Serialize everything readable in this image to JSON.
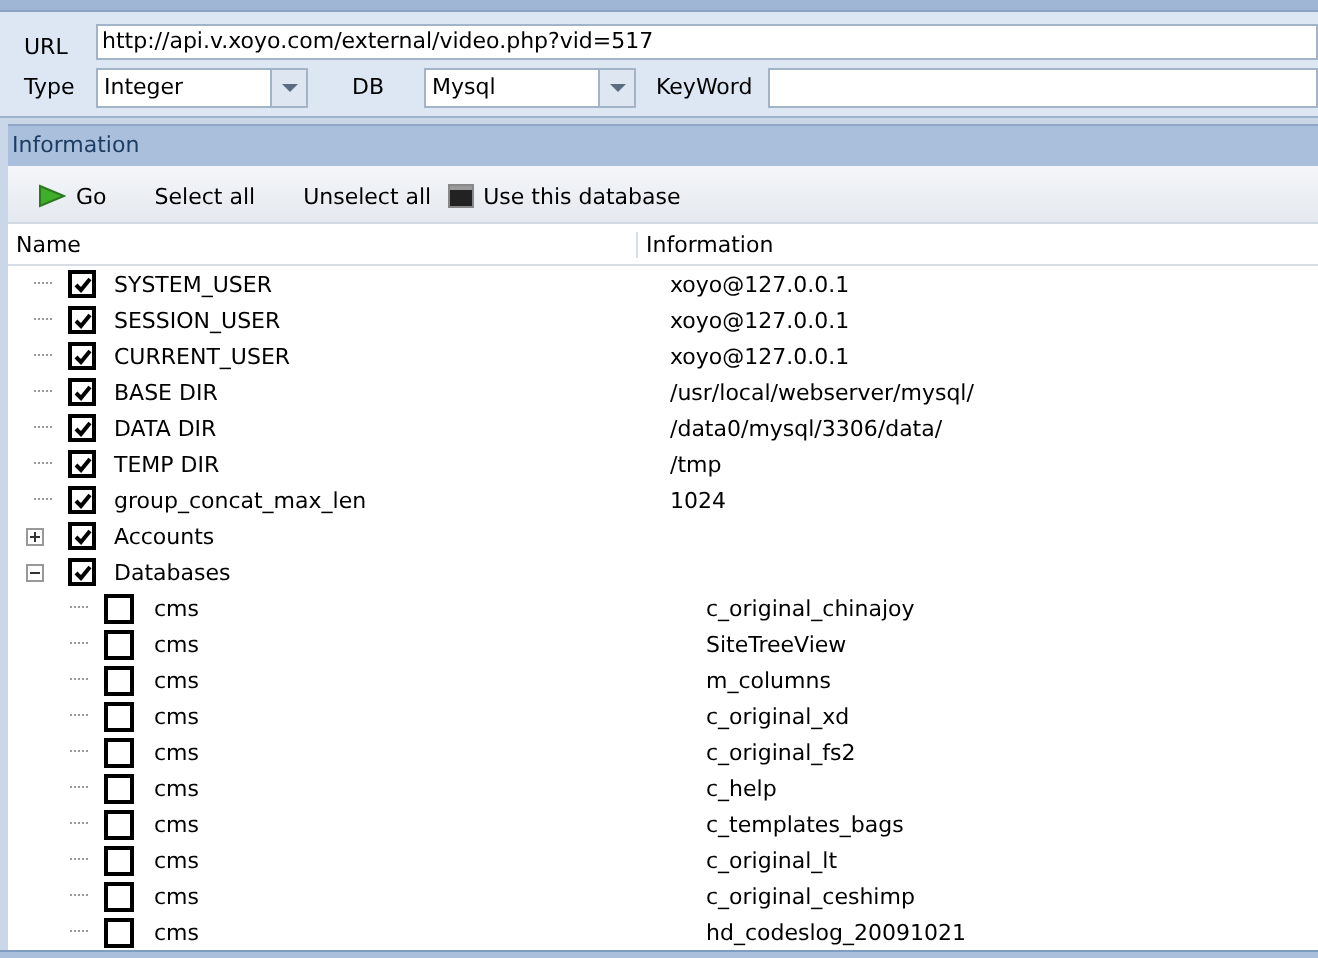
{
  "form": {
    "url_label": "URL",
    "url": "http://api.v.xoyo.com/external/video.php?vid=517",
    "type_label": "Type",
    "type": "Integer",
    "db_label": "DB",
    "db": "Mysql",
    "keyword_label": "KeyWord"
  },
  "panel": {
    "title": "Information"
  },
  "toolbar": [
    {
      "kind": "go",
      "label": "Go"
    },
    {
      "kind": "plain",
      "label": "Select all"
    },
    {
      "kind": "plain",
      "label": "Unselect all"
    },
    {
      "kind": "db",
      "label": "Use this database"
    }
  ],
  "tree": {
    "columns": [
      "Name",
      "Information"
    ],
    "items": [
      {
        "name": "SYSTEM_USER",
        "info": "xoyo@127.0.0.1",
        "checked": true
      },
      {
        "name": "SESSION_USER",
        "info": "xoyo@127.0.0.1",
        "checked": true
      },
      {
        "name": "CURRENT_USER",
        "info": "xoyo@127.0.0.1",
        "checked": true
      },
      {
        "name": "BASE DIR",
        "info": "/usr/local/webserver/mysql/",
        "checked": true
      },
      {
        "name": "DATA DIR",
        "info": "/data0/mysql/3306/data/",
        "checked": true
      },
      {
        "name": "TEMP DIR",
        "info": "/tmp",
        "checked": true
      },
      {
        "name": "group_concat_max_len",
        "info": "1024",
        "checked": true
      },
      {
        "name": "Accounts",
        "checked": true,
        "expanded": false
      },
      {
        "name": "Databases",
        "checked": true,
        "expanded": true,
        "children": [
          {
            "name": "cms",
            "info": "c_original_chinajoy",
            "checked": false
          },
          {
            "name": "cms",
            "info": "SiteTreeView",
            "checked": false
          },
          {
            "name": "cms",
            "info": "m_columns",
            "checked": false
          },
          {
            "name": "cms",
            "info": "c_original_xd",
            "checked": false
          },
          {
            "name": "cms",
            "info": "c_original_fs2",
            "checked": false
          },
          {
            "name": "cms",
            "info": "c_help",
            "checked": false
          },
          {
            "name": "cms",
            "info": "c_templates_bags",
            "checked": false
          },
          {
            "name": "cms",
            "info": "c_original_lt",
            "checked": false
          },
          {
            "name": "cms",
            "info": "c_original_ceshimp",
            "checked": false
          },
          {
            "name": "cms",
            "info": "hd_codeslog_20091021",
            "checked": false
          }
        ]
      }
    ]
  }
}
